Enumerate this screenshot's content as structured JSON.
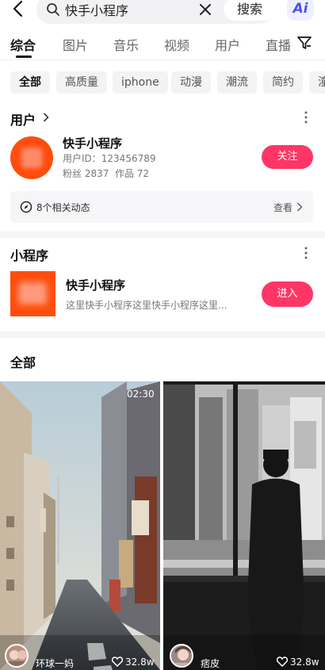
{
  "search": {
    "query": "快手小程序",
    "button_label": "搜索",
    "ai_label": "Ai"
  },
  "tabs": [
    "综合",
    "图片",
    "音乐",
    "视频",
    "用户",
    "直播"
  ],
  "chips": [
    "全部",
    "高质量",
    "iphone",
    "动漫",
    "潮流",
    "简约",
    "潼"
  ],
  "users_section": {
    "title": "用户",
    "user": {
      "name": "快手小程序",
      "id_line": "用户ID：123456789",
      "stats_line": "粉丝 2837  作品 72",
      "follow_label": "关注"
    },
    "dynamics": {
      "text": "8个相关动态",
      "view_label": "查看"
    }
  },
  "mini_program_section": {
    "title": "小程序",
    "item": {
      "name": "快手小程序",
      "description": "这里快手小程序这里快手小程序这里...",
      "enter_label": "进入"
    }
  },
  "all_section": {
    "title": "全部",
    "videos": [
      {
        "duration": "02:30",
        "author": "环球一妈",
        "likes": "32.8w"
      },
      {
        "author": "痞皮",
        "likes": "32.8w"
      }
    ]
  },
  "colors": {
    "accent": "#fe3666",
    "brand": "#ff4d0d"
  }
}
